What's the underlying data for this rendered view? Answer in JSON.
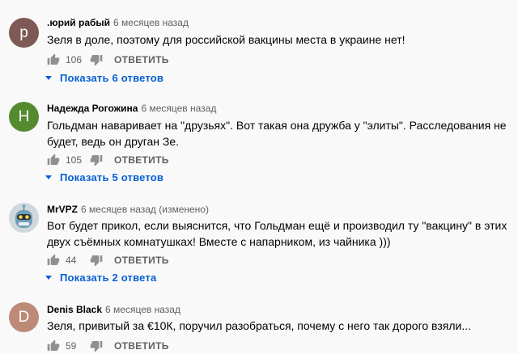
{
  "colors": {
    "link": "#065fd4",
    "secondary": "#606060",
    "text": "#030303"
  },
  "comments": [
    {
      "avatar_letter": "р",
      "avatar_color": "#7e5a57",
      "author": ".юрий рабый",
      "time": "6 месяцев назад",
      "text": "Зеля в доле, поэтому для российской вакцины места в украине нет!",
      "likes": "106",
      "reply_label": "ОТВЕТИТЬ",
      "replies_label": "Показать 6 ответов"
    },
    {
      "avatar_letter": "Н",
      "avatar_color": "#558b2f",
      "author": "Надежда Рогожина",
      "time": "6 месяцев назад",
      "text": "Гольдман наваривает на  \"друзьях\". Вот такая она дружба у \"элиты\". Расследования не будет, ведь он друган Зе.",
      "likes": "105",
      "reply_label": "ОТВЕТИТЬ",
      "replies_label": "Показать 5 ответов"
    },
    {
      "avatar_icon": "robot-avatar-icon",
      "author": "MrVPZ",
      "time": "6 месяцев назад (изменено)",
      "text": "Вот будет прикол, если выяснится, что Гольдман ещё и производил ту \"вакцину\" в этих двух съёмных комнатушках! Вместе с напарником, из чайника )))",
      "likes": "44",
      "reply_label": "ОТВЕТИТЬ",
      "replies_label": "Показать 2 ответа"
    },
    {
      "avatar_letter": "D",
      "avatar_color": "#bc8a77",
      "author": "Denis Black",
      "time": "6 месяцев назад",
      "text": "Зеля, привитый за €10К, поручил разобраться, почему с него так дорого взяли...",
      "likes": "59",
      "reply_label": "ОТВЕТИТЬ"
    }
  ]
}
